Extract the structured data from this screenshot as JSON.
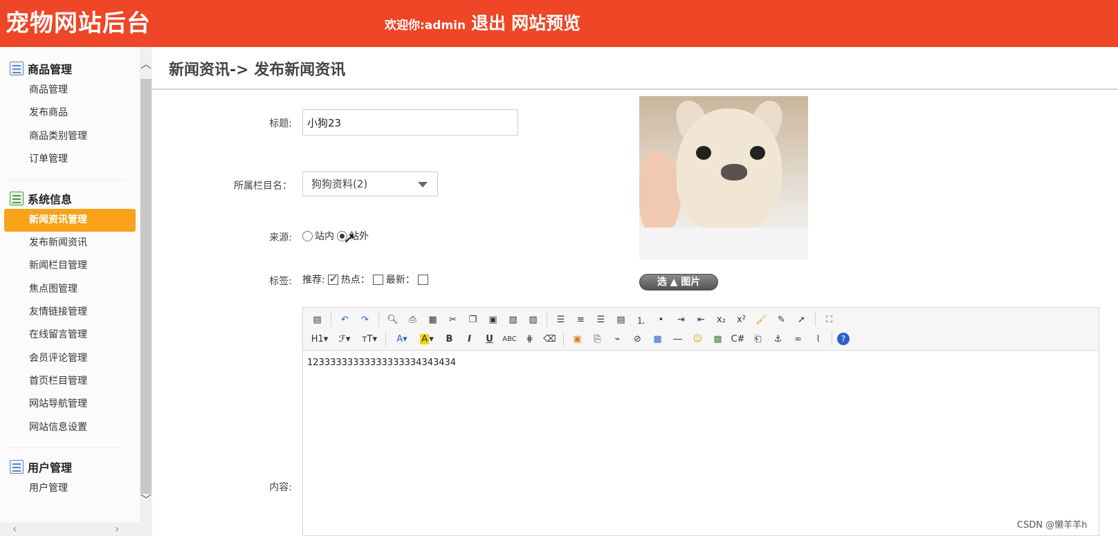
{
  "header": {
    "brand": "宠物网站后台",
    "welcome": "欢迎你:admin",
    "logout": "退出",
    "preview": "网站预览",
    "bg_color": "#ee4626"
  },
  "sidebar": {
    "groups": [
      {
        "title": "商品管理",
        "icon": "list-icon",
        "items": [
          "商品管理",
          "发布商品",
          "商品类别管理",
          "订单管理"
        ]
      },
      {
        "title": "系统信息",
        "icon": "system-icon",
        "items": [
          "新闻资讯管理",
          "发布新闻资讯",
          "新闻栏目管理",
          "焦点图管理",
          "友情链接管理",
          "在线留言管理",
          "会员评论管理",
          "首页栏目管理",
          "网站导航管理",
          "网站信息设置"
        ]
      },
      {
        "title": "用户管理",
        "icon": "list-icon",
        "items": [
          "用户管理"
        ]
      }
    ],
    "active_item": "新闻资讯管理",
    "active_color": "#f9a21a"
  },
  "page": {
    "breadcrumb": "新闻资讯-> 发布新闻资讯"
  },
  "form": {
    "title_label": "标题:",
    "title_value": "小狗23",
    "category_label": "所属栏目名：",
    "category_value": "狗狗资料(2)",
    "source_label": "来源:",
    "source_options": [
      "站内",
      "站外"
    ],
    "source_selected": "站外",
    "tags_label": "标签:",
    "tag_recommend": "推荐:",
    "tag_hot": "热点：",
    "tag_new": "最新：",
    "tag_recommend_checked": true,
    "tag_hot_checked": false,
    "tag_new_checked": false,
    "content_label": "内容:",
    "content_value": "12333333333333333334343434",
    "pick_image_button": "选 ▲ 图片"
  },
  "editor_toolbar": {
    "row1": [
      "source-icon",
      "undo-icon",
      "redo-icon",
      "preview-icon",
      "print-icon",
      "template-icon",
      "cut-icon",
      "copy-icon",
      "paste-icon",
      "paste-text-icon",
      "paste-word-icon",
      "align-left-icon",
      "align-center-icon",
      "align-right-icon",
      "justify-icon",
      "ordered-list-icon",
      "unordered-list-icon",
      "indent-icon",
      "outdent-icon",
      "subscript-icon",
      "superscript-icon",
      "clear-format-icon",
      "select-all-icon",
      "select-icon",
      "fullscreen-icon"
    ],
    "row2": [
      "heading-icon",
      "font-family-icon",
      "font-size-icon",
      "font-color-icon",
      "highlight-icon",
      "bold-icon",
      "italic-icon",
      "underline-icon",
      "strikethrough-icon",
      "line-height-icon",
      "eraser-icon",
      "image-icon",
      "multi-image-icon",
      "flash-icon",
      "attachment-icon",
      "table-icon",
      "hr-icon",
      "emoticon-icon",
      "map-icon",
      "code-icon",
      "pagebreak-icon",
      "anchor-icon",
      "link-icon",
      "unlink-icon",
      "help-icon"
    ]
  },
  "watermark": "CSDN @懒羊羊h"
}
